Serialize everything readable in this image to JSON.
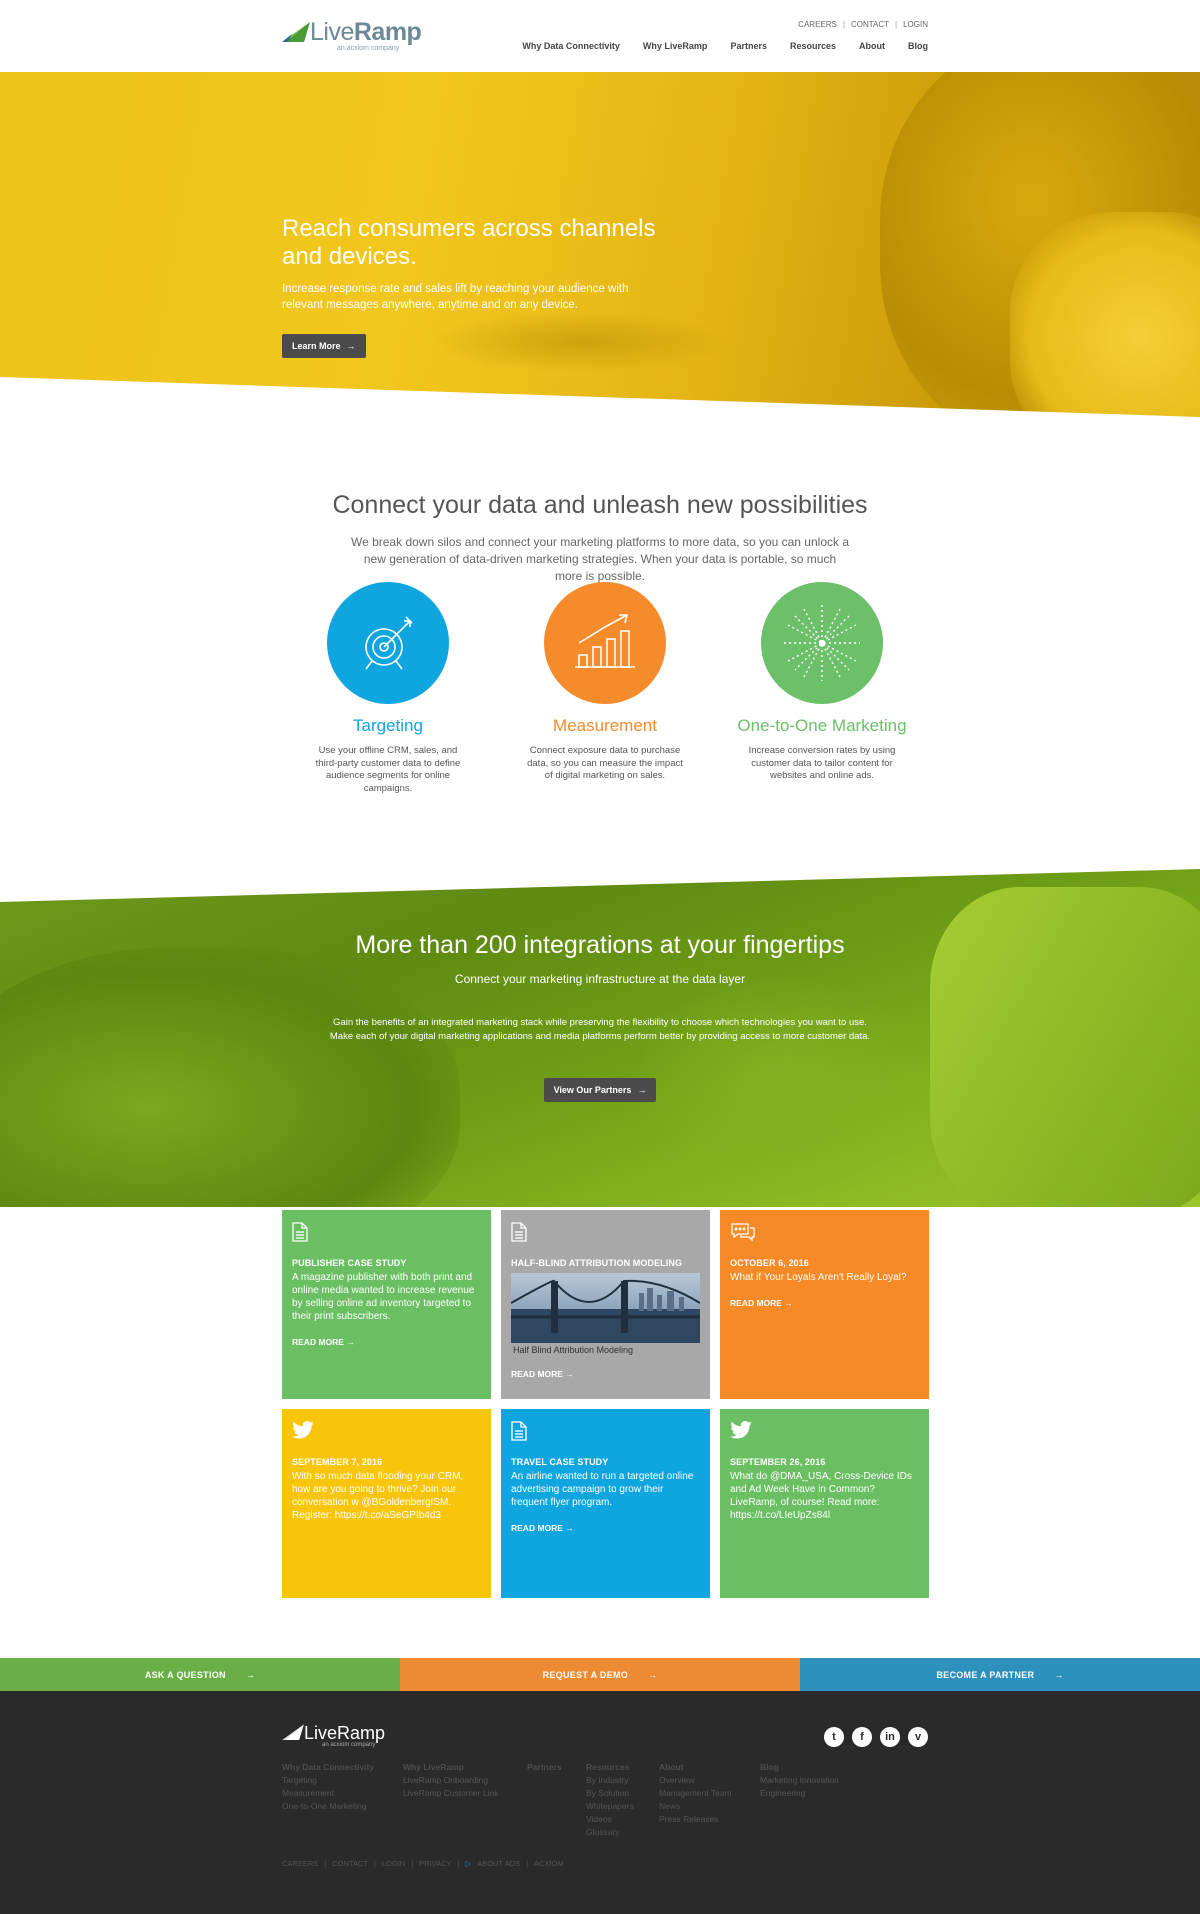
{
  "header": {
    "logo_text": "LiveRamp",
    "logo_sub": "an acxiom company",
    "util_links": [
      "CAREERS",
      "CONTACT",
      "LOGIN"
    ],
    "nav": [
      "Why Data Connectivity",
      "Why LiveRamp",
      "Partners",
      "Resources",
      "About",
      "Blog"
    ]
  },
  "hero": {
    "title": "Reach consumers across channels and devices.",
    "text": "Increase response rate and sales lift by reaching your audience with relevant messages anywhere, anytime and on any device.",
    "button": "Learn More"
  },
  "connect": {
    "title": "Connect your data and unleash new possibilities",
    "text": "We break down silos and connect your marketing platforms to more data, so you can unlock a new generation of data-driven marketing strategies. When your data is portable, so much more is possible.",
    "features": [
      {
        "title": "Targeting",
        "text": "Use your offline CRM, sales, and third-party customer data to define audience segments for online campaigns.",
        "color": "#0fa5de",
        "icon": "target-icon"
      },
      {
        "title": "Measurement",
        "text": "Connect exposure data to purchase data, so you can measure the impact of digital marketing on sales.",
        "color": "#f68b2c",
        "icon": "bar-growth-icon"
      },
      {
        "title": "One-to-One Marketing",
        "text": "Increase conversion rates by using customer data to tailor content for websites and online ads.",
        "color": "#6cc06a",
        "icon": "burst-icon"
      }
    ]
  },
  "integrations": {
    "title": "More than 200 integrations at your fingertips",
    "subtitle": "Connect your marketing infrastructure at the data layer",
    "text": "Gain the benefits of an integrated marketing stack while preserving the flexibility to choose which technologies you want to use. Make each of your digital marketing applications and media platforms perform better by providing access to more customer data.",
    "button": "View Our Partners"
  },
  "tiles": [
    {
      "icon": "document-icon",
      "color": "#6bbf63",
      "head": "PUBLISHER CASE STUDY",
      "body": "A magazine publisher with both print and online media wanted to increase revenue by selling online ad inventory targeted to their print subscribers.",
      "link": "READ MORE"
    },
    {
      "icon": "document-icon",
      "color": "#a8a8a8",
      "head": "HALF-BLIND ATTRIBUTION MODELING",
      "caption": "Half Blind Attribution Modeling",
      "link": "READ MORE"
    },
    {
      "icon": "chat-icon",
      "color": "#f68a27",
      "head": "OCTOBER 6, 2016",
      "body": "What if Your Loyals Aren't Really Loyal?",
      "link": "READ MORE"
    },
    {
      "icon": "twitter-icon",
      "color": "#f8c50b",
      "head": "SEPTEMBER 7, 2016",
      "body": "With so much data flooding your CRM, how are you going to thrive? Join our conversation w @BGoldenbergISM. Register: https://t.co/aSeGPIb4d3"
    },
    {
      "icon": "document-icon",
      "color": "#0fa5de",
      "head": "TRAVEL CASE STUDY",
      "body": "An airline wanted to run a targeted online advertising campaign to grow their frequent flyer program.",
      "link": "READ MORE"
    },
    {
      "icon": "twitter-icon",
      "color": "#6bbf63",
      "head": "SEPTEMBER 26, 2016",
      "body": "What do @DMA_USA, Cross-Device IDs and Ad Week Have in Common? LiveRamp, of course! Read more: https://t.co/LIeUpZs84l"
    }
  ],
  "cta": [
    {
      "label": "ASK A QUESTION",
      "color": "#6aaf45"
    },
    {
      "label": "REQUEST A DEMO",
      "color": "#ee8a32"
    },
    {
      "label": "BECOME A PARTNER",
      "color": "#2e90bd"
    }
  ],
  "footer": {
    "logo_text": "LiveRamp",
    "logo_sub": "an acxiom company",
    "social": [
      "twitter-icon",
      "facebook-icon",
      "linkedin-icon",
      "vimeo-icon"
    ],
    "columns": [
      {
        "head": "Why Data Connectivity",
        "items": [
          "Targeting",
          "Measurement",
          "One-to-One Marketing"
        ]
      },
      {
        "head": "Why LiveRamp",
        "items": [
          "LiveRamp Onboarding",
          "LiveRamp Customer Link"
        ]
      },
      {
        "head": "Partners",
        "items": []
      },
      {
        "head": "Resources",
        "items": [
          "By Industry",
          "By Solution",
          "Whitepapers",
          "Videos",
          "Glossary"
        ]
      },
      {
        "head": "About",
        "items": [
          "Overview",
          "Management Team",
          "News",
          "Press Releases"
        ]
      },
      {
        "head": "Blog",
        "items": [
          "Marketing Innovation",
          "Engineering"
        ]
      }
    ],
    "bottom_links": [
      "CAREERS",
      "CONTACT",
      "LOGIN",
      "PRIVACY",
      "ABOUT ADS",
      "ACXIOM"
    ]
  }
}
